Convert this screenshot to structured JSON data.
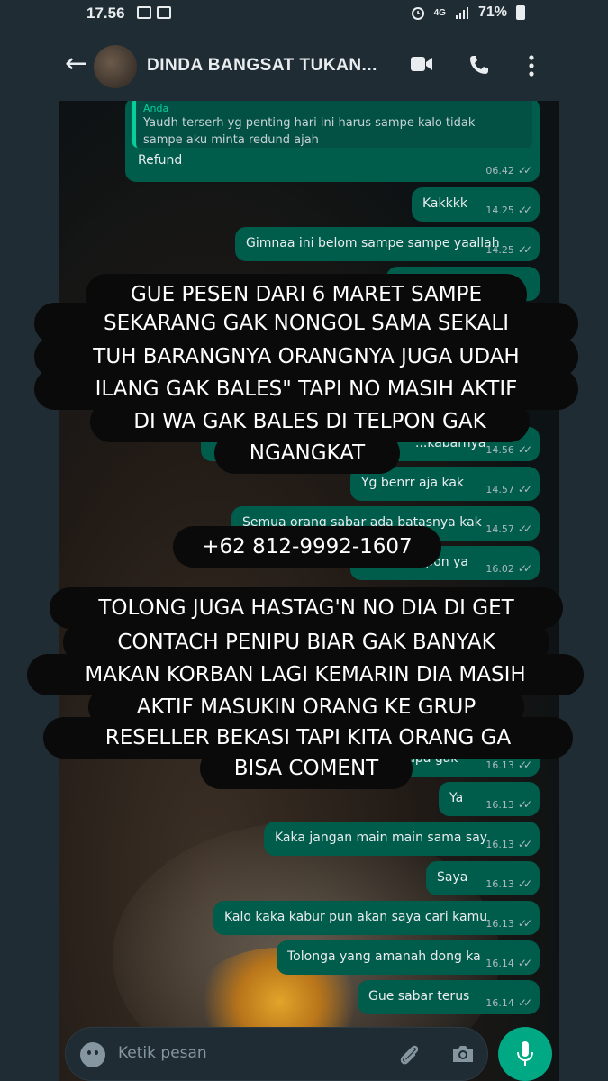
{
  "status_bar": {
    "time": "17.56",
    "network": "4G",
    "battery": "71%"
  },
  "header": {
    "back": "←",
    "chat_name": "DINDA BANGSAT TUKAN..."
  },
  "quoted_message": {
    "sender": "Anda",
    "text": "Yaudh terserh yg penting hari ini harus sampe kalo tidak sampe aku minta redund ajah",
    "reply": "Refund",
    "time": "06.42"
  },
  "messages": [
    {
      "text": "Kakkkk",
      "time": "14.25"
    },
    {
      "text": "Gimnaa ini belom sampe sampe yaallah",
      "time": "14.25"
    },
    {
      "text": "...kabarnya",
      "time": "14.56"
    },
    {
      "text": "Yg benrr aja kak",
      "time": "14.57"
    },
    {
      "text": "Semua orang sabar ada batasnya kak",
      "time": "14.57"
    },
    {
      "text": "...pon ya",
      "time": "16.02"
    },
    {
      "text": "...apa gak",
      "time": "16.13"
    },
    {
      "text": "Ya",
      "time": "16.13"
    },
    {
      "text": "Kaka jangan main main sama say",
      "time": "16.13"
    },
    {
      "text": "Saya",
      "time": "16.13"
    },
    {
      "text": "Kalo kaka kabur pun akan saya cari kamu",
      "time": "16.13"
    },
    {
      "text": "Tolonga yang amanah dong ka",
      "time": "16.14"
    },
    {
      "text": "Gue sabar terus",
      "time": "16.14"
    }
  ],
  "caption_1": [
    "GUE PESEN DARI 6 MARET SAMPE",
    "SEKARANG GAK NONGOL SAMA SEKALI",
    "TUH BARANGNYA ORANGNYA JUGA UDAH",
    "ILANG GAK BALES\" TAPI NO MASIH AKTIF",
    "DI WA GAK BALES DI TELPON GAK",
    "NGANGKAT"
  ],
  "caption_phone": "+62 812-9992-1607",
  "caption_2": [
    "TOLONG JUGA HASTAG'N NO DIA DI GET",
    "CONTACH PENIPU BIAR GAK BANYAK",
    "MAKAN KORBAN LAGI KEMARIN DIA MASIH",
    "AKTIF MASUKIN ORANG KE GRUP",
    "RESELLER BEKASI TAPI KITA ORANG GA",
    "BISA COMENT"
  ],
  "input": {
    "placeholder": "Ketik pesan"
  },
  "colors": {
    "header_bg": "#1f2c34",
    "outgoing_bubble": "#005c4b",
    "accent": "#00a884",
    "caption_bg": "#0a0a0a"
  }
}
